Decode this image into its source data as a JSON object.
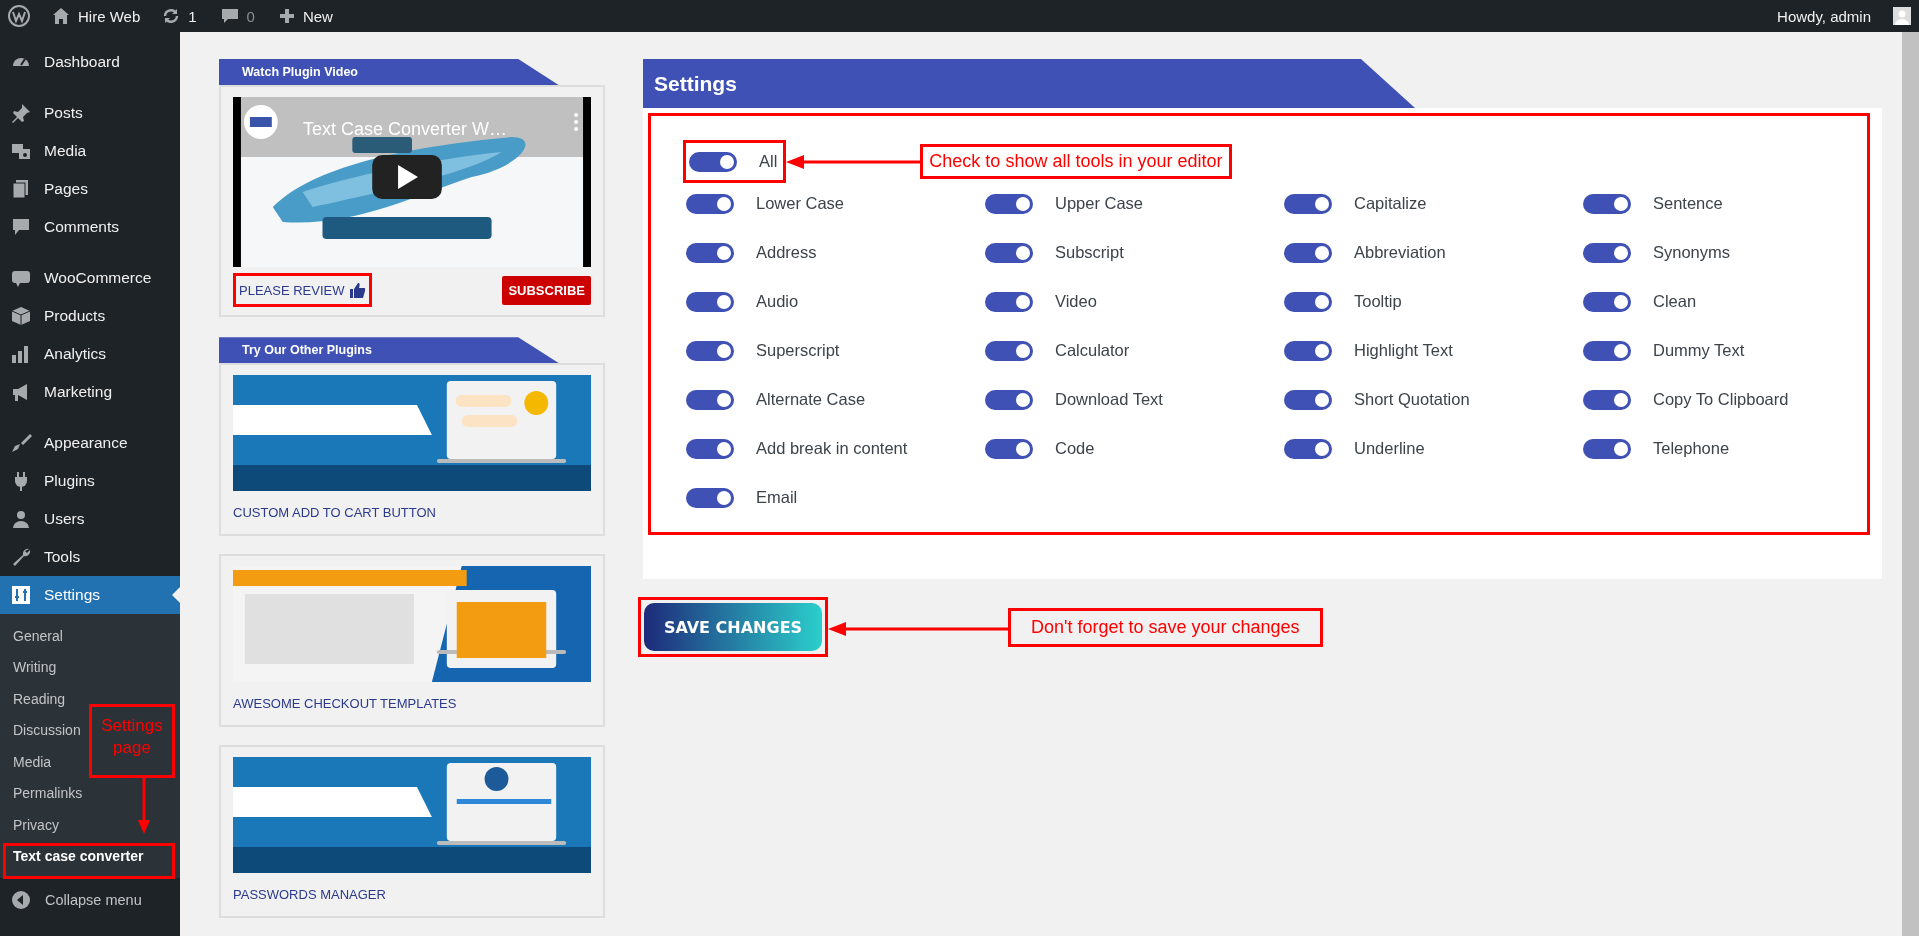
{
  "admin_bar": {
    "site_name": "Hire Web",
    "updates": "1",
    "comments": "0",
    "new_label": "New",
    "greeting": "Howdy, admin"
  },
  "sidebar": {
    "menu_groups": [
      {
        "items": [
          {
            "label": "Dashboard",
            "selected": false
          }
        ]
      },
      {
        "items": [
          {
            "label": "Posts",
            "selected": false
          },
          {
            "label": "Media",
            "selected": false
          },
          {
            "label": "Pages",
            "selected": false
          },
          {
            "label": "Comments",
            "selected": false
          }
        ]
      },
      {
        "items": [
          {
            "label": "WooCommerce",
            "selected": false
          },
          {
            "label": "Products",
            "selected": false
          },
          {
            "label": "Analytics",
            "selected": false
          },
          {
            "label": "Marketing",
            "selected": false
          }
        ]
      },
      {
        "items": [
          {
            "label": "Appearance",
            "selected": false
          },
          {
            "label": "Plugins",
            "selected": false
          },
          {
            "label": "Users",
            "selected": false
          },
          {
            "label": "Tools",
            "selected": false
          },
          {
            "label": "Settings",
            "selected": true
          }
        ]
      }
    ],
    "submenu": [
      {
        "label": "General",
        "selected": false
      },
      {
        "label": "Writing",
        "selected": false
      },
      {
        "label": "Reading",
        "selected": false
      },
      {
        "label": "Discussion",
        "selected": false
      },
      {
        "label": "Media",
        "selected": false
      },
      {
        "label": "Permalinks",
        "selected": false
      },
      {
        "label": "Privacy",
        "selected": false
      },
      {
        "label": "Text case converter",
        "selected": true
      }
    ],
    "collapse_label": "Collapse menu"
  },
  "video_panel": {
    "title": "Watch Plugin Video",
    "video": {
      "title": "Text Case Converter W…"
    },
    "review_label": "PLEASE REVIEW",
    "subscribe_label": "SUBSCRIBE"
  },
  "plugins_panel": {
    "title": "Try Our Other Plugins",
    "plugins": [
      {
        "name": "CUSTOM ADD TO CART BUTTON"
      },
      {
        "name": "AWESOME CHECKOUT TEMPLATES"
      },
      {
        "name": "PASSWORDS MANAGER"
      }
    ]
  },
  "settings": {
    "title": "Settings",
    "all_toggle": {
      "label": "All",
      "checked": true
    },
    "tools": [
      {
        "label": "Lower Case",
        "checked": true
      },
      {
        "label": "Upper Case",
        "checked": true
      },
      {
        "label": "Capitalize",
        "checked": true
      },
      {
        "label": "Sentence",
        "checked": true
      },
      {
        "label": "Address",
        "checked": true
      },
      {
        "label": "Subscript",
        "checked": true
      },
      {
        "label": "Abbreviation",
        "checked": true
      },
      {
        "label": "Synonyms",
        "checked": true
      },
      {
        "label": "Audio",
        "checked": true
      },
      {
        "label": "Video",
        "checked": true
      },
      {
        "label": "Tooltip",
        "checked": true
      },
      {
        "label": "Clean",
        "checked": true
      },
      {
        "label": "Superscript",
        "checked": true
      },
      {
        "label": "Calculator",
        "checked": true
      },
      {
        "label": "Highlight Text",
        "checked": true
      },
      {
        "label": "Dummy Text",
        "checked": true
      },
      {
        "label": "Alternate Case",
        "checked": true
      },
      {
        "label": "Download Text",
        "checked": true
      },
      {
        "label": "Short Quotation",
        "checked": true
      },
      {
        "label": "Copy To Clipboard",
        "checked": true
      },
      {
        "label": "Add break in content",
        "checked": true
      },
      {
        "label": "Code",
        "checked": true
      },
      {
        "label": "Underline",
        "checked": true
      },
      {
        "label": "Telephone",
        "checked": true
      },
      {
        "label": "Email",
        "checked": true
      }
    ],
    "save_label": "SAVE CHANGES"
  },
  "annotations": [
    {
      "text": "Check to show all tools in your editor"
    },
    {
      "text": "Don't forget to save your changes"
    },
    {
      "text": "Settings page"
    }
  ]
}
